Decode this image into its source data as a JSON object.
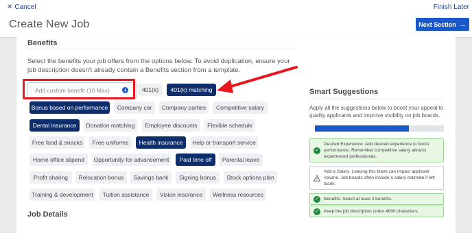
{
  "header": {
    "cancel_label": "Cancel",
    "finish_label": "Finish Later",
    "title": "Create New Job",
    "next_label": "Next Section"
  },
  "benefits": {
    "heading": "Benefits",
    "description": "Select the benefits your job offers from the options below. To avoid duplication, ensure your job description doesn't already contain a Benefits section from a template.",
    "custom_placeholder": "Add custom benefit (10 Max)",
    "chips": [
      {
        "label": "401(k)",
        "selected": false
      },
      {
        "label": "401(k) matching",
        "selected": true
      },
      {
        "label": "Bonus based on performance",
        "selected": true
      },
      {
        "label": "Company car",
        "selected": false
      },
      {
        "label": "Company parties",
        "selected": false
      },
      {
        "label": "Competitive salary",
        "selected": false
      },
      {
        "label": "Dental insurance",
        "selected": true
      },
      {
        "label": "Donation matching",
        "selected": false
      },
      {
        "label": "Employee discounts",
        "selected": false
      },
      {
        "label": "Flexible schedule",
        "selected": false
      },
      {
        "label": "Free food & snacks",
        "selected": false
      },
      {
        "label": "Free uniforms",
        "selected": false
      },
      {
        "label": "Health insurance",
        "selected": true
      },
      {
        "label": "Help or transport service",
        "selected": false
      },
      {
        "label": "Home office stipend",
        "selected": false
      },
      {
        "label": "Opportunity for advancement",
        "selected": false
      },
      {
        "label": "Paid time off",
        "selected": true
      },
      {
        "label": "Parental leave",
        "selected": false
      },
      {
        "label": "Profit sharing",
        "selected": false
      },
      {
        "label": "Relocation bonus",
        "selected": false
      },
      {
        "label": "Savings bank",
        "selected": false
      },
      {
        "label": "Signing bonus",
        "selected": false
      },
      {
        "label": "Stock options plan",
        "selected": false
      },
      {
        "label": "Training & development",
        "selected": false
      },
      {
        "label": "Tuition assistance",
        "selected": false
      },
      {
        "label": "Vision insurance",
        "selected": false
      },
      {
        "label": "Wellness resources",
        "selected": false
      }
    ]
  },
  "job_details": {
    "heading": "Job Details"
  },
  "smart": {
    "heading": "Smart Suggestions",
    "description": "Apply all the suggestions below to boost your appeal to quality applicants and improve visibility on job boards.",
    "progress": 0.73,
    "progress_label": "73%",
    "suggestions": [
      {
        "type": "ok",
        "text": "Desired Experience: Add desired experience to boost performance. Remember competitive salary attracts experienced professionals."
      },
      {
        "type": "warn",
        "text": "Add a Salary: Leaving this blank can impact applicant volume. Job boards often include a salary estimate if left blank."
      },
      {
        "type": "ok",
        "text": "Benefits: Select at least 3 benefits."
      },
      {
        "type": "ok",
        "text": "Keep the job description under 4000 characters."
      }
    ]
  },
  "colors": {
    "accent": "#1a57c9",
    "selected_chip": "#0e2d6b",
    "highlight": "#e8171f",
    "success": "#1f8a3e"
  }
}
